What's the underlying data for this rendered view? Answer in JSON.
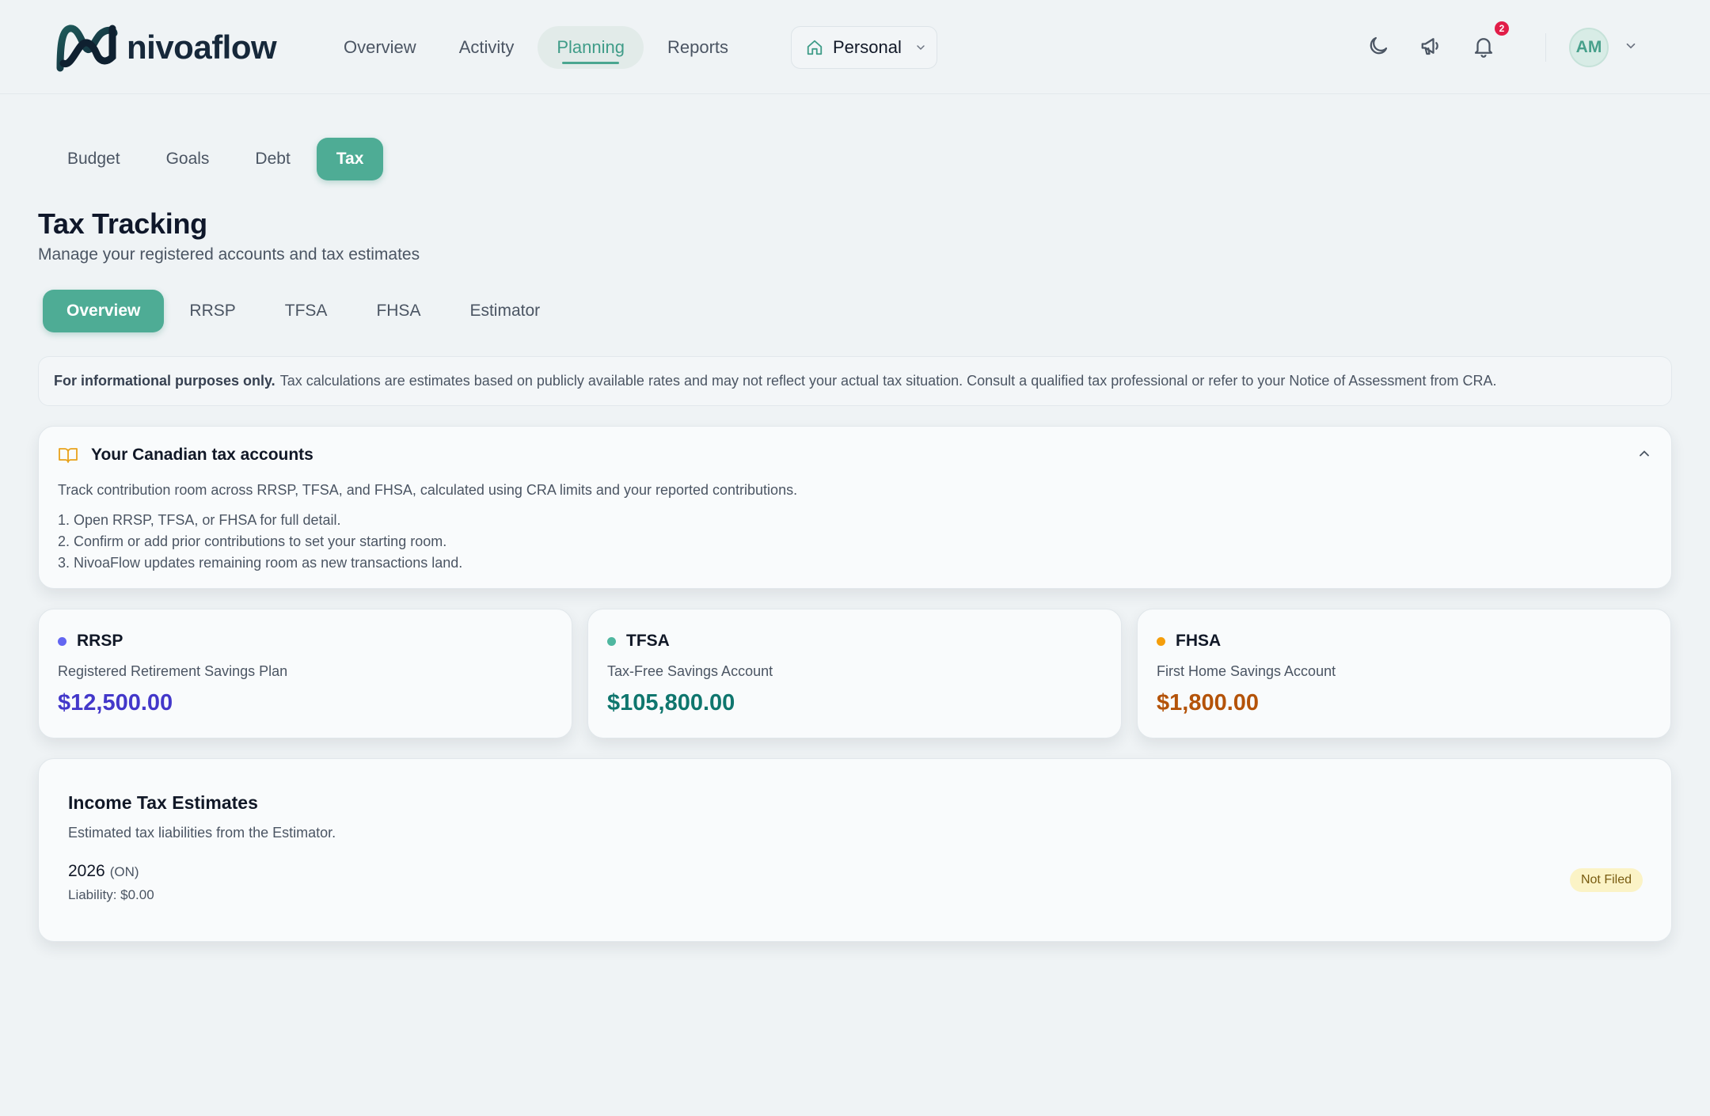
{
  "app": {
    "name": "nivoaflow",
    "nav": [
      "Overview",
      "Activity",
      "Planning",
      "Reports"
    ],
    "active_nav": "Planning",
    "scope_label": "Personal",
    "notification_count": "2",
    "avatar_initials": "AM"
  },
  "subtabs": [
    "Budget",
    "Goals",
    "Debt",
    "Tax"
  ],
  "page": {
    "title": "Tax Tracking",
    "subtitle": "Manage your registered accounts and tax estimates"
  },
  "innertabs": [
    "Overview",
    "RRSP",
    "TFSA",
    "FHSA",
    "Estimator"
  ],
  "disclaimer": {
    "bold": "For informational purposes only.",
    "text": "Tax calculations are estimates based on publicly available rates and may not reflect your actual tax situation. Consult a qualified tax professional or refer to your Notice of Assessment from CRA."
  },
  "info": {
    "title": "Your Canadian tax accounts",
    "description": "Track contribution room across RRSP, TFSA, and FHSA, calculated using CRA limits and your reported contributions.",
    "steps": [
      "1. Open RRSP, TFSA, or FHSA for full detail.",
      "2. Confirm or add prior contributions to set your starting room.",
      "3. NivoaFlow updates remaining room as new transactions land."
    ]
  },
  "accounts": [
    {
      "name": "RRSP",
      "description": "Registered Retirement Savings Plan",
      "balance": "$12,500.00",
      "dot_color": "#6366f1",
      "balance_color": "#4338ca"
    },
    {
      "name": "TFSA",
      "description": "Tax-Free Savings Account",
      "balance": "$105,800.00",
      "dot_color": "#4fb7a0",
      "balance_color": "#0f766e"
    },
    {
      "name": "FHSA",
      "description": "First Home Savings Account",
      "balance": "$1,800.00",
      "dot_color": "#f59e0b",
      "balance_color": "#b45309"
    }
  ],
  "tax_estimates": {
    "title": "Income Tax Estimates",
    "subtitle": "Estimated tax liabilities from the Estimator.",
    "entries": [
      {
        "year": "2026",
        "province": "(ON)",
        "liability": "Liability: $0.00",
        "status": "Not Filed"
      }
    ]
  },
  "colors": {
    "accent": "#4eac95",
    "brand_dark": "#16283a",
    "badge": "#e11d48"
  }
}
